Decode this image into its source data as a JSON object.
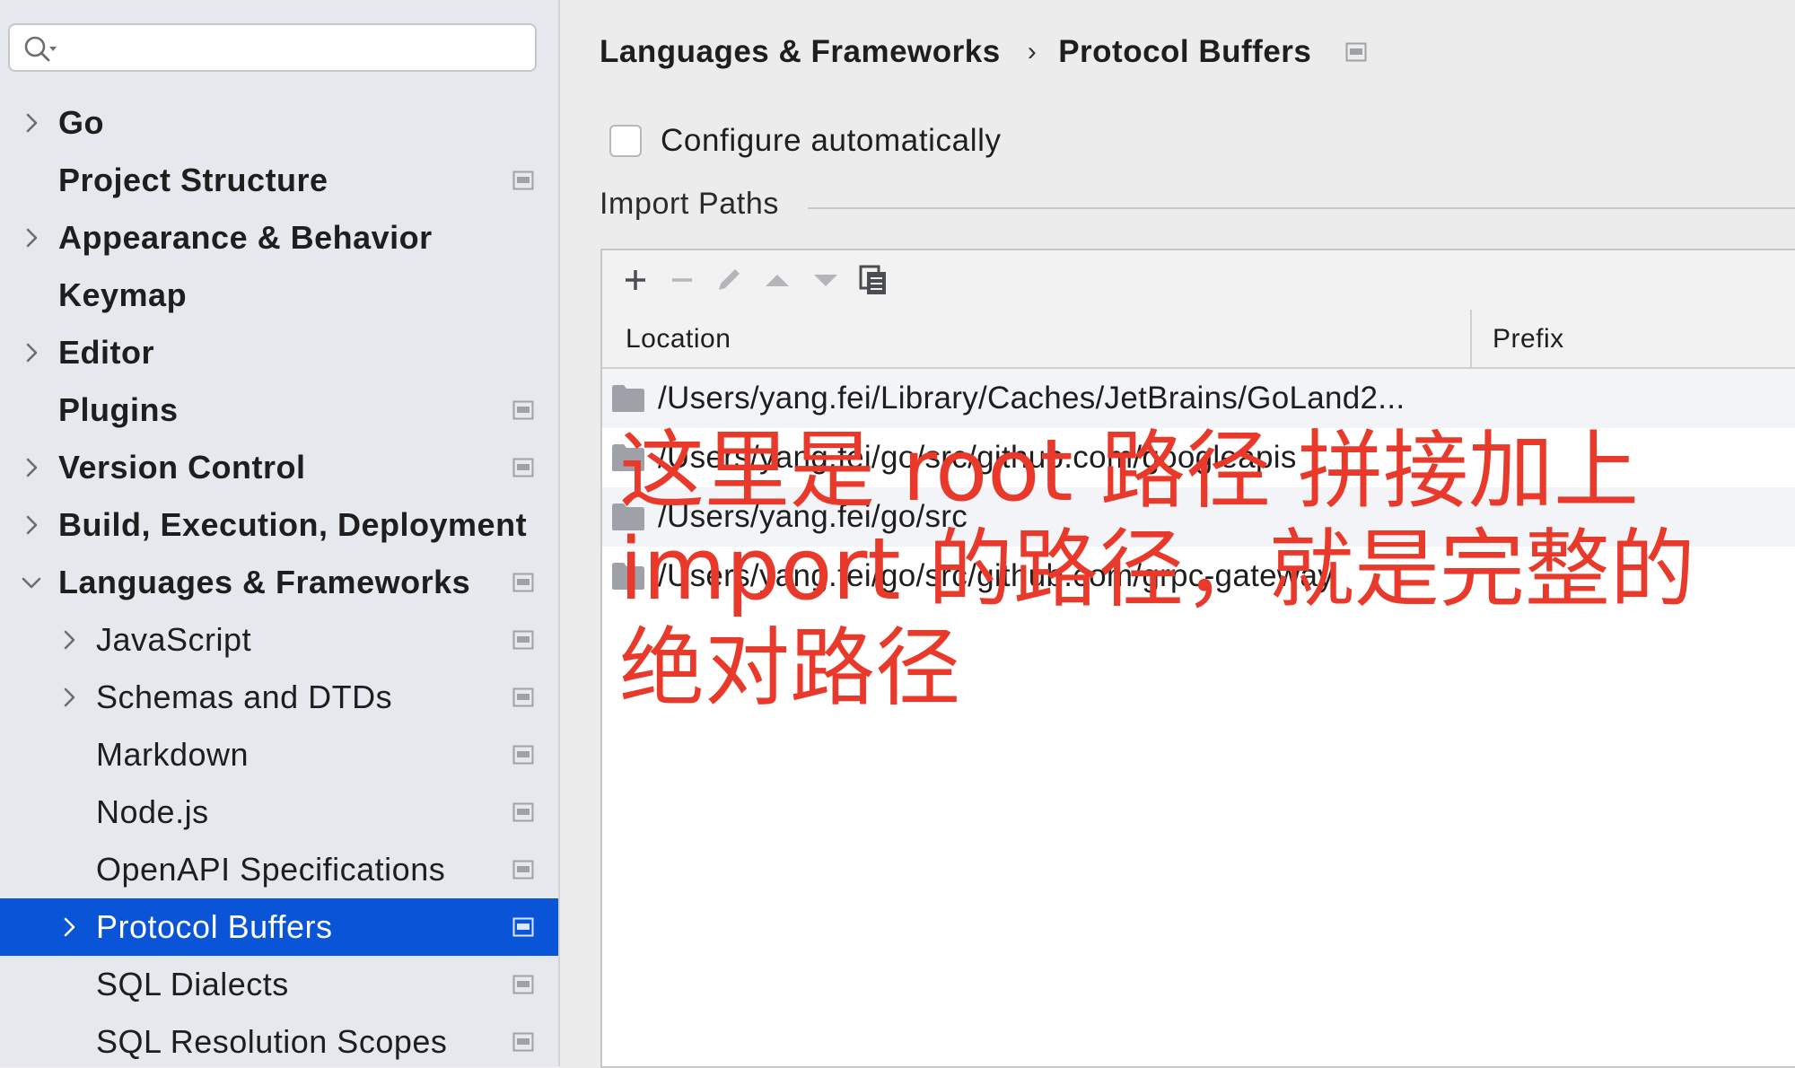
{
  "sidebar": {
    "search": {
      "placeholder": "",
      "icon": "search-icon"
    },
    "items": [
      {
        "label": "Go",
        "level": 0,
        "expandable": true,
        "expanded": false,
        "badge": false
      },
      {
        "label": "Project Structure",
        "level": 0,
        "expandable": false,
        "badge": true
      },
      {
        "label": "Appearance & Behavior",
        "level": 0,
        "expandable": true,
        "expanded": false,
        "badge": false
      },
      {
        "label": "Keymap",
        "level": 0,
        "expandable": false,
        "badge": false
      },
      {
        "label": "Editor",
        "level": 0,
        "expandable": true,
        "expanded": false,
        "badge": false
      },
      {
        "label": "Plugins",
        "level": 0,
        "expandable": false,
        "badge": true
      },
      {
        "label": "Version Control",
        "level": 0,
        "expandable": true,
        "expanded": false,
        "badge": true
      },
      {
        "label": "Build, Execution, Deployment",
        "level": 0,
        "expandable": true,
        "expanded": false,
        "badge": false
      },
      {
        "label": "Languages & Frameworks",
        "level": 0,
        "expandable": true,
        "expanded": true,
        "badge": true
      },
      {
        "label": "JavaScript",
        "level": 1,
        "expandable": true,
        "expanded": false,
        "badge": true
      },
      {
        "label": "Schemas and DTDs",
        "level": 1,
        "expandable": true,
        "expanded": false,
        "badge": true
      },
      {
        "label": "Markdown",
        "level": 1,
        "expandable": false,
        "badge": true
      },
      {
        "label": "Node.js",
        "level": 1,
        "expandable": false,
        "badge": true
      },
      {
        "label": "OpenAPI Specifications",
        "level": 1,
        "expandable": false,
        "badge": true
      },
      {
        "label": "Protocol Buffers",
        "level": 1,
        "expandable": true,
        "expanded": false,
        "badge": true,
        "selected": true
      },
      {
        "label": "SQL Dialects",
        "level": 1,
        "expandable": false,
        "badge": true
      },
      {
        "label": "SQL Resolution Scopes",
        "level": 1,
        "expandable": false,
        "badge": true
      }
    ]
  },
  "breadcrumb": {
    "parent": "Languages & Frameworks",
    "separator": "›",
    "current": "Protocol Buffers"
  },
  "configure": {
    "label": "Configure automatically",
    "checked": false
  },
  "import_paths": {
    "title": "Import Paths",
    "toolbar": [
      "add-icon",
      "remove-icon",
      "edit-icon",
      "move-up-icon",
      "move-down-icon",
      "copy-icon"
    ],
    "columns": {
      "location": "Location",
      "prefix": "Prefix"
    },
    "rows": [
      "/Users/yang.fei/Library/Caches/JetBrains/GoLand2...",
      "/Users/yang.fei/go/src/github.com/googleapis",
      "/Users/yang.fei/go/src",
      "/Users/yang.fei/go/src/github.com/grpc-gateway"
    ]
  },
  "annotation": {
    "text": "这里是 root 路径 拼接加上 import 的路径，就是完整的绝对路径",
    "color": "#e8392a"
  },
  "colors": {
    "selection": "#0a54d8",
    "sidebar_bg": "#e5e8ec",
    "main_bg": "#ececec"
  }
}
